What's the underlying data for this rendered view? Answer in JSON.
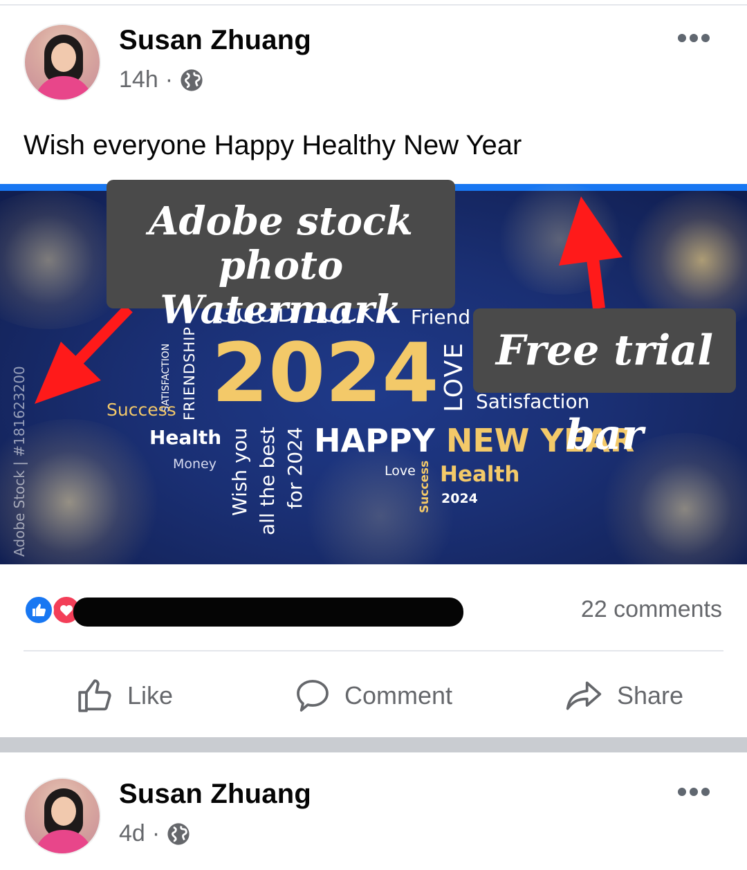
{
  "posts": [
    {
      "author": "Susan Zhuang",
      "time": "14h",
      "separator": "·",
      "caption": "Wish everyone Happy Healthy New Year",
      "image": {
        "words": {
          "good_luck": "GOOD LUCK",
          "friend": "Friend",
          "satisfaction_small": "SATISFACTION",
          "friendship": "FRIENDSHIP",
          "year": "2024",
          "love_big": "LOVE",
          "satisfaction": "Satisfaction",
          "success": "Success",
          "health": "Health",
          "money": "Money",
          "wish_you": "Wish you",
          "all_the_best": "all the best",
          "for_2024": "for 2024",
          "happy_new_year": "HAPPY NEW YEAR",
          "love_small": "Love",
          "success_small": "Success",
          "health_gold": "Health",
          "year_small": "2024"
        },
        "side_watermark": "Adobe Stock | #181623200"
      },
      "annotations": {
        "watermark_label_line1": "Adobe stock photo",
        "watermark_label_line2": "Watermark",
        "trial_label": "Free trial bar"
      },
      "comments_count": "22 comments",
      "actions": {
        "like": "Like",
        "comment": "Comment",
        "share": "Share"
      }
    },
    {
      "author": "Susan Zhuang",
      "time": "4d",
      "separator": "·"
    }
  ],
  "colors": {
    "trial_bar": "#1877f2",
    "annotation_arrow": "#ff1a1a",
    "like_blue": "#1877f2",
    "love_red": "#f33e58",
    "gold_text": "#f3c969"
  },
  "icons": [
    "globe-icon",
    "more-icon",
    "like-reaction-icon",
    "love-reaction-icon",
    "like-icon",
    "comment-icon",
    "share-icon",
    "arrow-icon"
  ]
}
